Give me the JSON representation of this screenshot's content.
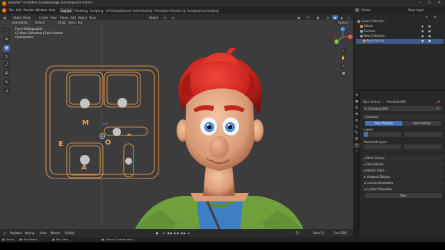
{
  "window": {
    "title": "Blender* [F:\\B\\Mio Youtube\\Rigg Tools\\Joystick.blend]",
    "minimize": "–",
    "maximize": "□",
    "close": "✕"
  },
  "menu": [
    "File",
    "Edit",
    "Render",
    "Window",
    "Help"
  ],
  "workspaces": [
    {
      "label": "Layout",
      "active": true
    },
    {
      "label": "Modeling",
      "active": false
    },
    {
      "label": "Sculpting",
      "active": false
    },
    {
      "label": "UV Editing",
      "active": false
    },
    {
      "label": "Texture Paint",
      "active": false
    },
    {
      "label": "Shading",
      "active": false
    },
    {
      "label": "Animation",
      "active": false
    },
    {
      "label": "Rendering",
      "active": false
    },
    {
      "label": "Compositing",
      "active": false
    },
    {
      "label": "Scripting",
      "active": false
    }
  ],
  "scene": {
    "label": "Scene",
    "view_layer": "View Layer"
  },
  "viewport_header": {
    "mode": "Object Mode",
    "menus": [
      "View",
      "Select",
      "Add",
      "Object"
    ],
    "create": "Create",
    "tools": "Tools",
    "transform_orientation": "Global",
    "orientation_label": "Orientation:",
    "orientation_value": "Default",
    "drag_label": "Drag:",
    "drag_value": "Select Box",
    "options": "Options"
  },
  "viewport_overlay": {
    "view_name": "Front Orthographic",
    "collection_object": "(1) New Collection | Face Control",
    "units": "Centimeters"
  },
  "joystick_letters": [
    "M",
    "E",
    "O",
    "A"
  ],
  "tools": [
    {
      "icon": "select-box-icon",
      "glyph": "⬚",
      "active": false
    },
    {
      "icon": "cursor-icon",
      "glyph": "⊕",
      "active": false
    },
    {
      "icon": "move-icon",
      "glyph": "✥",
      "active": true
    },
    {
      "icon": "rotate-icon",
      "glyph": "↻",
      "active": false
    },
    {
      "icon": "scale-icon",
      "glyph": "⤢",
      "active": false
    },
    {
      "icon": "transform-icon",
      "glyph": "⊞",
      "active": false
    },
    {
      "icon": "annotate-icon",
      "glyph": "✎",
      "active": false
    },
    {
      "icon": "measure-icon",
      "glyph": "📐",
      "active": false
    }
  ],
  "nav_gizmo": {
    "z": "Z",
    "y": "Y",
    "x": "X"
  },
  "timeline": {
    "playback": "Playback",
    "keying": "Keying",
    "view": "View",
    "marker": "Marker",
    "interpolation": "Linear",
    "current_frame": "1",
    "start_label": "Start",
    "start": "1",
    "end_label": "End",
    "end": "250"
  },
  "status": {
    "select": "Select",
    "box_select": "Box Select",
    "pan_view": "Pan View",
    "context_menu": "Object Context Menu"
  },
  "outliner": {
    "rows": [
      {
        "label": "Scene Collection",
        "indent": 0,
        "selected": false,
        "color": "#d0d0d0"
      },
      {
        "label": "Album",
        "indent": 1,
        "selected": false,
        "color": "#d0d0d0"
      },
      {
        "label": "Camera",
        "indent": 1,
        "selected": false,
        "color": "#d0d0d0"
      },
      {
        "label": "New Collection",
        "indent": 1,
        "selected": false,
        "color": "#d0d0d0"
      },
      {
        "label": "Face Control",
        "indent": 2,
        "selected": true,
        "color": "#f0f0f0"
      }
    ]
  },
  "properties": {
    "breadcrumb_1": "Face Control",
    "breadcrumb_2": "Armature.003",
    "datablock": "Armature.003",
    "skeleton": {
      "title": "Skeleton",
      "pose_position": "Pose Position",
      "rest_position": "Rest Position"
    },
    "layers_label": "Layers",
    "protected_layers_label": "Protected Layers",
    "panels": [
      "Bone Groups",
      "Pose Library",
      "Motion Paths",
      "Viewport Display",
      "Inverse Kinematics",
      "Custom Properties"
    ],
    "new_button": "New"
  },
  "colors": {
    "accent": "#4772b3",
    "wire_orange": "#d8924a",
    "viewport_bg": "#3c3c3c",
    "hair_red": "#c8241c",
    "skin": "#e2a785",
    "shirt_green": "#6fa03c",
    "shirt_blue": "#3f7fc4"
  }
}
